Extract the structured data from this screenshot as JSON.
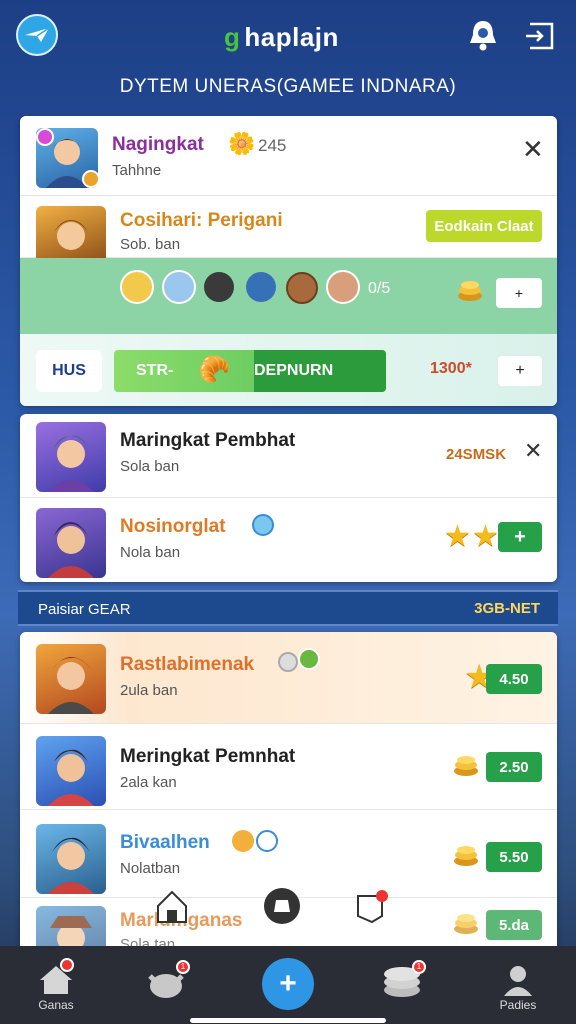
{
  "header": {
    "title": "haplajn",
    "title_prefix": "g",
    "subtitle": "DYTEM UNERAS(GAMEE INDNARA)"
  },
  "panel1": {
    "row1": {
      "name": "Nagingkat",
      "score": "245",
      "sub": "Tahhne"
    },
    "row2": {
      "name": "Cosihari: Perigani",
      "sub": "Sob. ban",
      "action": "Eodkain Claat"
    },
    "strip": {
      "count": "0/5",
      "plus": "+"
    },
    "bar": {
      "left": "HUS",
      "fill_left": "STR-",
      "fill_right": "DEPNURN",
      "value": "1300*",
      "btn": "+"
    }
  },
  "panel2": {
    "row1": {
      "name": "Maringkat Pembhat",
      "sub": "Sola ban",
      "value": "24SMSK"
    },
    "row2": {
      "name": "Nosinorglat",
      "sub": "Nola ban",
      "btn": "+"
    }
  },
  "section": {
    "left": "Paisiar GEAR",
    "right": "3GB-NET"
  },
  "panel3": [
    {
      "name": "Rastlabimenak",
      "sub": "2ula ban",
      "value": "4.50"
    },
    {
      "name": "Meringkat Pemnhat",
      "sub": "2ala kan",
      "value": "2.50"
    },
    {
      "name": "Bivaalhen",
      "sub": "Nolatban",
      "value": "5.50"
    },
    {
      "name": "Marldmganas",
      "sub": "Sola tan",
      "value": "5.da"
    }
  ],
  "nav": {
    "home": "Ganas",
    "profile": "Padies",
    "badge1": "1",
    "badge2": "1",
    "badge3": "1"
  },
  "colors": {
    "green": "#27a04a",
    "star": "#f4bb1f",
    "nav": "#2a2d35",
    "accent": "#2fa6e6"
  }
}
